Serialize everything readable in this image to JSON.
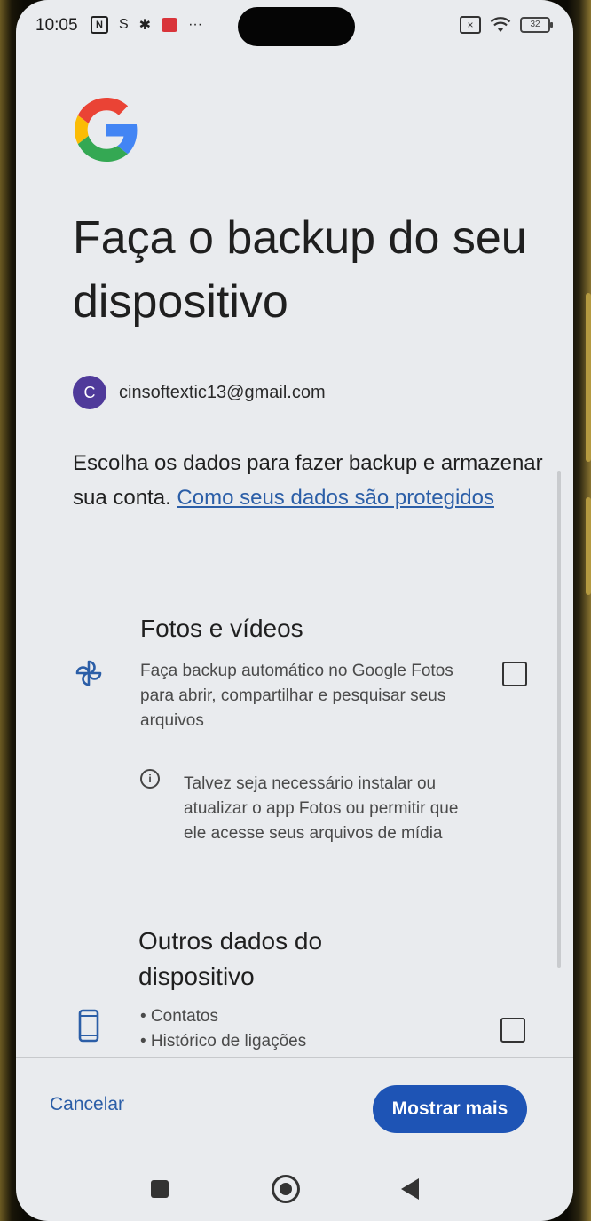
{
  "status_bar": {
    "time": "10:05",
    "left_icons": [
      "nfc-icon",
      "s-icon",
      "settings-icon",
      "mail-icon",
      "more-dots-icon"
    ],
    "more_dots": "···",
    "battery": "32"
  },
  "header": {
    "logo": "google-g-logo",
    "title": "Faça o backup do seu dispositivo"
  },
  "account": {
    "initial": "C",
    "email": "cinsoftextic13@gmail.com"
  },
  "intro": {
    "text": "Escolha os dados para fazer backup e armazenar sua conta. ",
    "link": "Como seus dados são protegidos"
  },
  "sections": {
    "photos": {
      "title": "Fotos e vídeos",
      "description": "Faça backup automático no Google Fotos para abrir, compartilhar e pesquisar seus arquivos",
      "checked": false,
      "icon": "pinwheel-icon"
    },
    "info_note": "Talvez seja necessário instalar ou atualizar o app Fotos ou permitir que ele acesse seus arquivos de mídia",
    "device": {
      "title": "Outros dados do dispositivo",
      "items": [
        "• Contatos",
        "• Histórico de ligações"
      ],
      "checked": false,
      "icon": "phone-icon"
    }
  },
  "footer": {
    "cancel_label": "Cancelar",
    "more_label": "Mostrar mais"
  },
  "colors": {
    "accent": "#1e54b5",
    "link": "#2b5ea7",
    "background": "#e9ebee",
    "avatar": "#4f3a9a"
  }
}
